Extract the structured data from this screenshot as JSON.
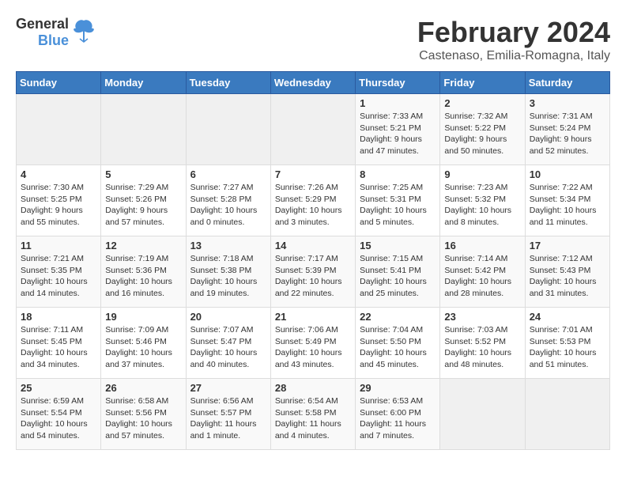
{
  "logo": {
    "general": "General",
    "blue": "Blue"
  },
  "title": "February 2024",
  "location": "Castenaso, Emilia-Romagna, Italy",
  "days_of_week": [
    "Sunday",
    "Monday",
    "Tuesday",
    "Wednesday",
    "Thursday",
    "Friday",
    "Saturday"
  ],
  "weeks": [
    [
      {
        "day": "",
        "info": ""
      },
      {
        "day": "",
        "info": ""
      },
      {
        "day": "",
        "info": ""
      },
      {
        "day": "",
        "info": ""
      },
      {
        "day": "1",
        "info": "Sunrise: 7:33 AM\nSunset: 5:21 PM\nDaylight: 9 hours and 47 minutes."
      },
      {
        "day": "2",
        "info": "Sunrise: 7:32 AM\nSunset: 5:22 PM\nDaylight: 9 hours and 50 minutes."
      },
      {
        "day": "3",
        "info": "Sunrise: 7:31 AM\nSunset: 5:24 PM\nDaylight: 9 hours and 52 minutes."
      }
    ],
    [
      {
        "day": "4",
        "info": "Sunrise: 7:30 AM\nSunset: 5:25 PM\nDaylight: 9 hours and 55 minutes."
      },
      {
        "day": "5",
        "info": "Sunrise: 7:29 AM\nSunset: 5:26 PM\nDaylight: 9 hours and 57 minutes."
      },
      {
        "day": "6",
        "info": "Sunrise: 7:27 AM\nSunset: 5:28 PM\nDaylight: 10 hours and 0 minutes."
      },
      {
        "day": "7",
        "info": "Sunrise: 7:26 AM\nSunset: 5:29 PM\nDaylight: 10 hours and 3 minutes."
      },
      {
        "day": "8",
        "info": "Sunrise: 7:25 AM\nSunset: 5:31 PM\nDaylight: 10 hours and 5 minutes."
      },
      {
        "day": "9",
        "info": "Sunrise: 7:23 AM\nSunset: 5:32 PM\nDaylight: 10 hours and 8 minutes."
      },
      {
        "day": "10",
        "info": "Sunrise: 7:22 AM\nSunset: 5:34 PM\nDaylight: 10 hours and 11 minutes."
      }
    ],
    [
      {
        "day": "11",
        "info": "Sunrise: 7:21 AM\nSunset: 5:35 PM\nDaylight: 10 hours and 14 minutes."
      },
      {
        "day": "12",
        "info": "Sunrise: 7:19 AM\nSunset: 5:36 PM\nDaylight: 10 hours and 16 minutes."
      },
      {
        "day": "13",
        "info": "Sunrise: 7:18 AM\nSunset: 5:38 PM\nDaylight: 10 hours and 19 minutes."
      },
      {
        "day": "14",
        "info": "Sunrise: 7:17 AM\nSunset: 5:39 PM\nDaylight: 10 hours and 22 minutes."
      },
      {
        "day": "15",
        "info": "Sunrise: 7:15 AM\nSunset: 5:41 PM\nDaylight: 10 hours and 25 minutes."
      },
      {
        "day": "16",
        "info": "Sunrise: 7:14 AM\nSunset: 5:42 PM\nDaylight: 10 hours and 28 minutes."
      },
      {
        "day": "17",
        "info": "Sunrise: 7:12 AM\nSunset: 5:43 PM\nDaylight: 10 hours and 31 minutes."
      }
    ],
    [
      {
        "day": "18",
        "info": "Sunrise: 7:11 AM\nSunset: 5:45 PM\nDaylight: 10 hours and 34 minutes."
      },
      {
        "day": "19",
        "info": "Sunrise: 7:09 AM\nSunset: 5:46 PM\nDaylight: 10 hours and 37 minutes."
      },
      {
        "day": "20",
        "info": "Sunrise: 7:07 AM\nSunset: 5:47 PM\nDaylight: 10 hours and 40 minutes."
      },
      {
        "day": "21",
        "info": "Sunrise: 7:06 AM\nSunset: 5:49 PM\nDaylight: 10 hours and 43 minutes."
      },
      {
        "day": "22",
        "info": "Sunrise: 7:04 AM\nSunset: 5:50 PM\nDaylight: 10 hours and 45 minutes."
      },
      {
        "day": "23",
        "info": "Sunrise: 7:03 AM\nSunset: 5:52 PM\nDaylight: 10 hours and 48 minutes."
      },
      {
        "day": "24",
        "info": "Sunrise: 7:01 AM\nSunset: 5:53 PM\nDaylight: 10 hours and 51 minutes."
      }
    ],
    [
      {
        "day": "25",
        "info": "Sunrise: 6:59 AM\nSunset: 5:54 PM\nDaylight: 10 hours and 54 minutes."
      },
      {
        "day": "26",
        "info": "Sunrise: 6:58 AM\nSunset: 5:56 PM\nDaylight: 10 hours and 57 minutes."
      },
      {
        "day": "27",
        "info": "Sunrise: 6:56 AM\nSunset: 5:57 PM\nDaylight: 11 hours and 1 minute."
      },
      {
        "day": "28",
        "info": "Sunrise: 6:54 AM\nSunset: 5:58 PM\nDaylight: 11 hours and 4 minutes."
      },
      {
        "day": "29",
        "info": "Sunrise: 6:53 AM\nSunset: 6:00 PM\nDaylight: 11 hours and 7 minutes."
      },
      {
        "day": "",
        "info": ""
      },
      {
        "day": "",
        "info": ""
      }
    ]
  ]
}
